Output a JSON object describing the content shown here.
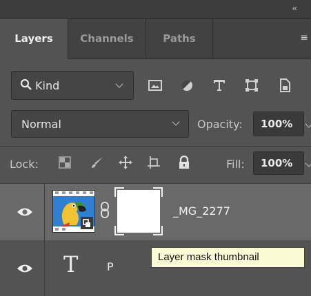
{
  "panel": {
    "collapse_glyph": "‹‹",
    "menu_glyph": "≡"
  },
  "tabs": [
    {
      "label": "Layers",
      "active": true
    },
    {
      "label": "Channels",
      "active": false
    },
    {
      "label": "Paths",
      "active": false
    }
  ],
  "filter": {
    "kind_label": "Kind",
    "icons": [
      "image-filter-icon",
      "adjustment-filter-icon",
      "type-filter-icon",
      "shape-filter-icon",
      "smart-object-filter-icon"
    ]
  },
  "blend": {
    "mode": "Normal",
    "opacity_label": "Opacity:",
    "opacity_value": "100%"
  },
  "lock": {
    "label": "Lock:",
    "icons": [
      "lock-transparent-pixels-icon",
      "lock-image-pixels-icon",
      "lock-position-icon",
      "lock-artboard-icon",
      "lock-all-icon"
    ],
    "fill_label": "Fill:",
    "fill_value": "100%"
  },
  "layers": [
    {
      "name": "_MG_2277",
      "type": "smart-object",
      "has_mask": true,
      "visible": true,
      "selected": true
    },
    {
      "name": "P",
      "type": "text",
      "visible": true,
      "selected": false
    }
  ],
  "tooltip": {
    "text": "Layer mask thumbnail"
  },
  "colors": {
    "panel_bg": "#535353",
    "selected_row": "#696969",
    "tooltip_bg": "#fbfbd6"
  }
}
